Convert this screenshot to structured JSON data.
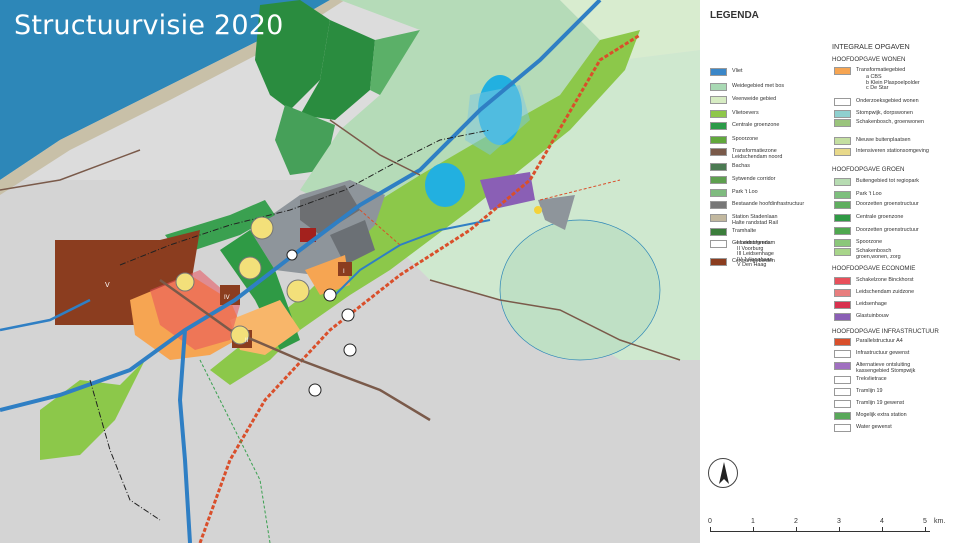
{
  "title": "Structuurvisie 2020",
  "legend": {
    "heading": "LEGENDA",
    "left_items": [
      {
        "label": "Vliet",
        "color": "#3b87c8"
      },
      {
        "label": "Weidegebied met bos",
        "color": "#a9d9b4"
      },
      {
        "label": "Veenweide gebied",
        "color": "#d7ecc3"
      },
      {
        "label": "Vlietoevers",
        "color": "#8fc74a"
      },
      {
        "label": "Centrale groenzone",
        "color": "#2b9b48"
      },
      {
        "label": "Spoorzone",
        "color": "#61a83c"
      },
      {
        "label": "Transformatiezone\nLeidschendam noord",
        "color": "#7a5a4a"
      },
      {
        "label": "Bachas",
        "color": "#4b7a52"
      },
      {
        "label": "Sytwende corridor",
        "color": "#5e9f4f"
      },
      {
        "label": "Park 't Loo",
        "color": "#7fbb7f"
      },
      {
        "label": "Bestaande hoofdinfrastructuur",
        "color": "#777777"
      },
      {
        "label": "Station Stadenlaan\nHalte randstad Rail",
        "color": "#c2b89f"
      },
      {
        "label": "Tramhalte",
        "color": "#3b7d3b"
      },
      {
        "label": "Gemeentegrens",
        "color": "#ffffff"
      },
      {
        "label": "Centrumgebieden",
        "color": "#8b3d1f"
      }
    ],
    "centrum_list": "I    Leidschendam\nII   Voorburg\nIII  Leidsenhage\nIV   Julianabaan\nV    Den Haag",
    "right_heading": "INTEGRALE OPGAVEN",
    "wonen_heading": "HOOFDOPGAVE WONEN",
    "wonen_items": [
      {
        "label": "Transformatiegebied",
        "sub": "a   CBS\nb   Klein Plaspoelpolder\nc   De Star",
        "color": "#f6a552"
      },
      {
        "label": "Onderzoeksgebied wonen",
        "sub": "",
        "color": "#ffffff"
      },
      {
        "label": "Stompwijk, dorpswonen",
        "sub": "",
        "color": "#8fd0cf"
      },
      {
        "label": "Schakenbosch, groenwonen",
        "sub": "",
        "color": "#9ac47c"
      },
      {
        "label": "Nieuwe buitenplaatsen",
        "sub": "",
        "color": "#c4dfa1"
      },
      {
        "label": "Intensiveren stationsomgeving",
        "sub": "",
        "color": "#e8d98a"
      }
    ],
    "groen_heading": "HOOFDOPGAVE GROEN",
    "groen_items": [
      {
        "label": "Buitengebied tot regiopark",
        "color": "#b7dcb2"
      },
      {
        "label": "Park 't Loo",
        "color": "#7dbf7d"
      },
      {
        "label": "Doorzetten groenstructuur",
        "color": "#5fae5f"
      },
      {
        "label": "Centrale groenzone",
        "color": "#2f9a45"
      },
      {
        "label": "Doorzetten groenstructuur",
        "color": "#4fa84f"
      },
      {
        "label": "Spoorzone",
        "color": "#8bc77a"
      },
      {
        "label": "Schakenbosch\ngroen,wonen, zorg",
        "color": "#a8d58a"
      }
    ],
    "economie_heading": "HOOFDOPGAVE ECONOMIE",
    "economie_items": [
      {
        "label": "Schakelzone Binckhorst",
        "color": "#e8505b"
      },
      {
        "label": "Leidschendam zuidzone",
        "color": "#e87e7e"
      },
      {
        "label": "Leidsenhage",
        "color": "#d8304e"
      },
      {
        "label": "Glastuinbouw",
        "color": "#8a5fb5"
      }
    ],
    "infra_heading": "HOOFDOPGAVE INFRASTRUCTUUR",
    "infra_items": [
      {
        "label": "Parallelstructuur A4",
        "color": "#d94f2b"
      },
      {
        "label": "Infrastructuur gewenst",
        "color": "#ffffff"
      },
      {
        "label": "Alternatieve ontsluiting\nkassengebied Stompwijk",
        "color": "#a070c0"
      },
      {
        "label": "Trekvlietrace",
        "color": "#ffffff"
      },
      {
        "label": "Tramlijn 19",
        "color": "#ffffff"
      },
      {
        "label": "Tramlijn 19 gewenst",
        "color": "#ffffff"
      },
      {
        "label": "Mogelijk extra station",
        "color": "#59a85a"
      },
      {
        "label": "Water gewenst",
        "color": "#ffffff"
      }
    ]
  },
  "scale": {
    "ticks": [
      "0",
      "1",
      "2",
      "3",
      "4",
      "5"
    ],
    "unit": "km."
  },
  "map_labels": {
    "centrum_v": "V",
    "centrum_ii": "II",
    "centrum_iv": "IV",
    "centrum_i": "I"
  }
}
